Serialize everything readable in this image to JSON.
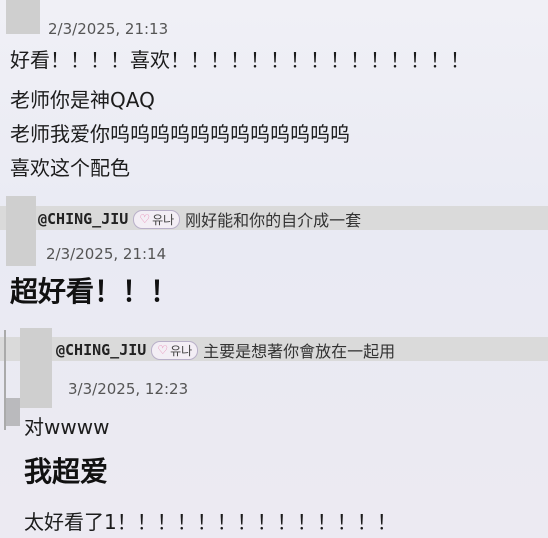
{
  "comment1": {
    "timestamp": "2/3/2025, 21:13",
    "lines": [
      "好看！！！！喜欢！！！！！！！！！！！！！！！",
      "老师你是神QAQ",
      "老师我爱你呜呜呜呜呜呜呜呜呜呜呜呜",
      "喜欢这个配色"
    ]
  },
  "comment2": {
    "reply_to": {
      "handle": "@CHING_JIU",
      "badge": "유나",
      "text": "刚好能和你的自介成一套"
    },
    "timestamp": "2/3/2025, 21:14",
    "message": "超好看！！！"
  },
  "comment3": {
    "reply_to": {
      "handle": "@CHING_JIU",
      "badge": "유나",
      "text": "主要是想著你會放在一起用"
    },
    "timestamp": "3/3/2025, 12:23",
    "lines": [
      "对wwww"
    ],
    "bold_line": "我超爱",
    "last_line": "太好看了1！！！！！！！！！！！！！！"
  },
  "colors": {
    "badge_heart": "#e46ca0",
    "reply_band": "#dadada"
  }
}
